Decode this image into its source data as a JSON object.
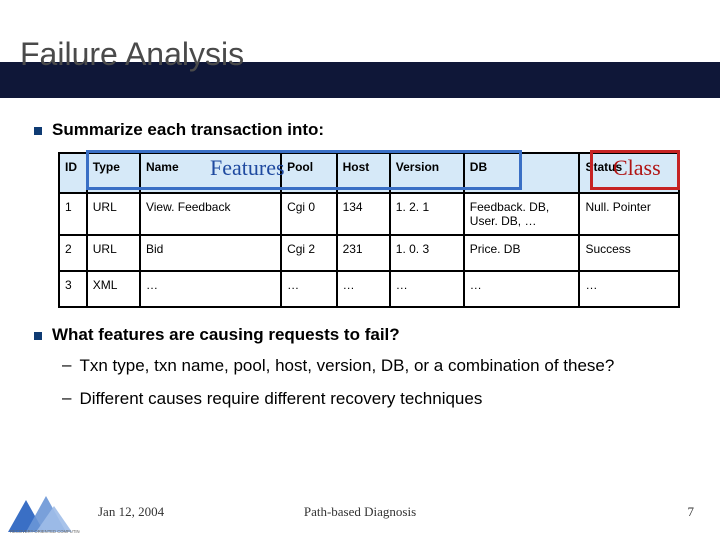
{
  "title": "Failure Analysis",
  "bullet1": "Summarize each transaction into:",
  "overlay": {
    "features": "Features",
    "class": "Class"
  },
  "table": {
    "headers": [
      "ID",
      "Type",
      "Name",
      "Pool",
      "Host",
      "Version",
      "DB",
      "Status"
    ],
    "rows": [
      [
        "1",
        "URL",
        "View. Feedback",
        "Cgi 0",
        "134",
        "1. 2. 1",
        "Feedback. DB, User. DB, …",
        "Null. Pointer"
      ],
      [
        "2",
        "URL",
        "Bid",
        "Cgi 2",
        "231",
        "1. 0. 3",
        "Price. DB",
        "Success"
      ],
      [
        "3",
        "XML",
        "…",
        "…",
        "…",
        "…",
        "…",
        "…"
      ]
    ]
  },
  "bullet2": "What features are causing requests to fail?",
  "dash1": "Txn type, txn name, pool, host, version, DB, or a combination of these?",
  "dash2": "Different causes require different recovery techniques",
  "footer": {
    "date": "Jan 12, 2004",
    "center": "Path-based Diagnosis",
    "page": "7"
  }
}
